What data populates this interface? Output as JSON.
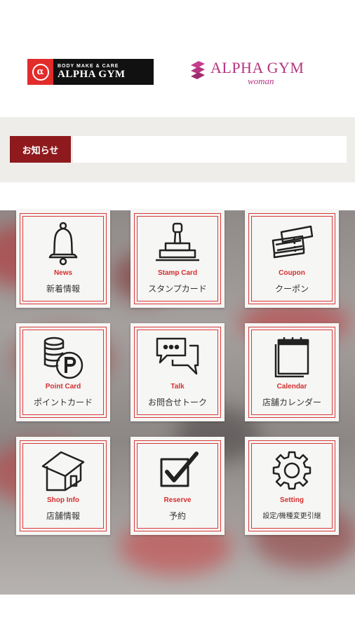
{
  "header": {
    "logo_left": {
      "tagline": "BODY MAKE & CARE",
      "name": "ALPHA GYM",
      "mark": "α"
    },
    "logo_right": {
      "name": "ALPHA GYM",
      "sub": "woman"
    }
  },
  "notice": {
    "label": "お知らせ",
    "text": ""
  },
  "menu": {
    "tiles": [
      {
        "icon": "bell-icon",
        "en": "News",
        "jp": "新着情報"
      },
      {
        "icon": "stamp-icon",
        "en": "Stamp Card",
        "jp": "スタンプカード"
      },
      {
        "icon": "coupon-icon",
        "en": "Coupon",
        "jp": "クーポン"
      },
      {
        "icon": "coins-icon",
        "en": "Point Card",
        "jp": "ポイントカード"
      },
      {
        "icon": "chat-icon",
        "en": "Talk",
        "jp": "お問合せトーク"
      },
      {
        "icon": "calendar-icon",
        "en": "Calendar",
        "jp": "店舗カレンダー"
      },
      {
        "icon": "house-icon",
        "en": "Shop Info",
        "jp": "店舗情報"
      },
      {
        "icon": "checkbox-icon",
        "en": "Reserve",
        "jp": "予約"
      },
      {
        "icon": "gear-icon",
        "en": "Setting",
        "jp": "設定/機種変更引継"
      }
    ]
  },
  "colors": {
    "accent": "#d32f2f",
    "notice_label_bg": "#8e1a1d",
    "woman_brand": "#b5357f"
  }
}
